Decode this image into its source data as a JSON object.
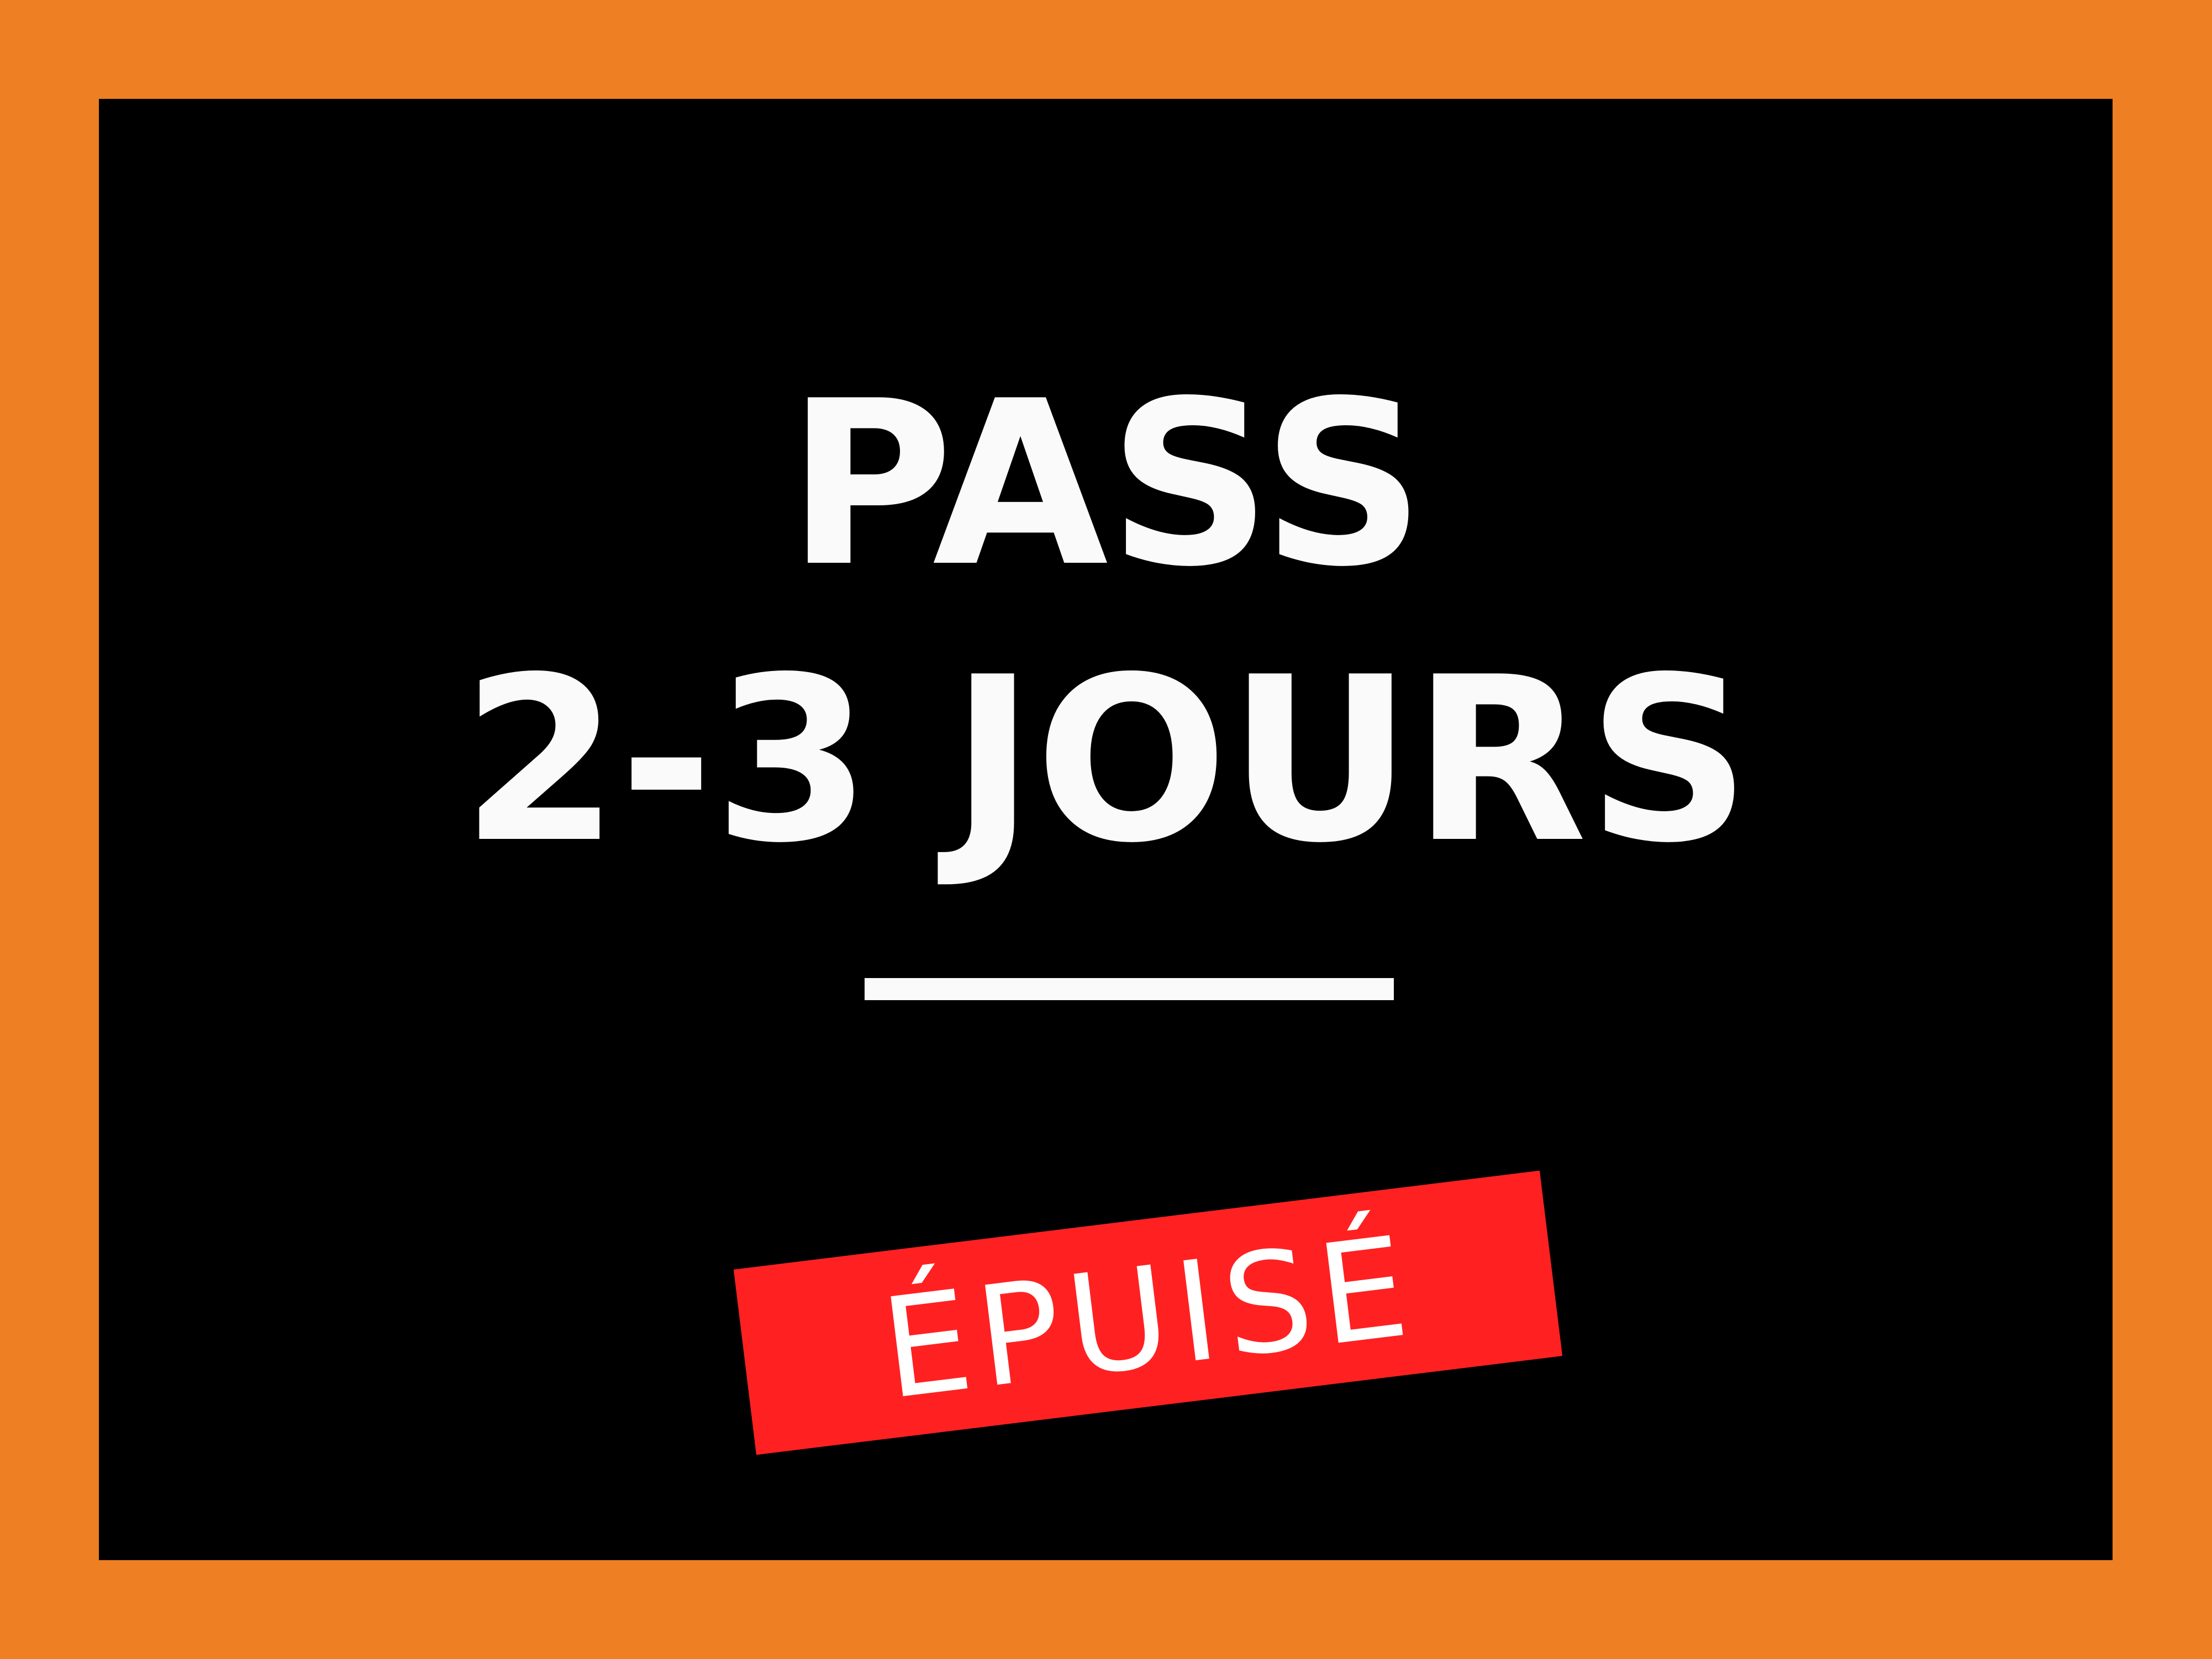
{
  "sign": {
    "title_line_1": "PASS",
    "title_line_2": "2-3 JOURS",
    "stamp_label": "ÉPUISÉ"
  },
  "colors": {
    "frame": "#EE7F22",
    "background": "#000000",
    "text": "#FAFAFA",
    "stamp": "#FF2121",
    "stamp_text": "#FFFFFF"
  }
}
